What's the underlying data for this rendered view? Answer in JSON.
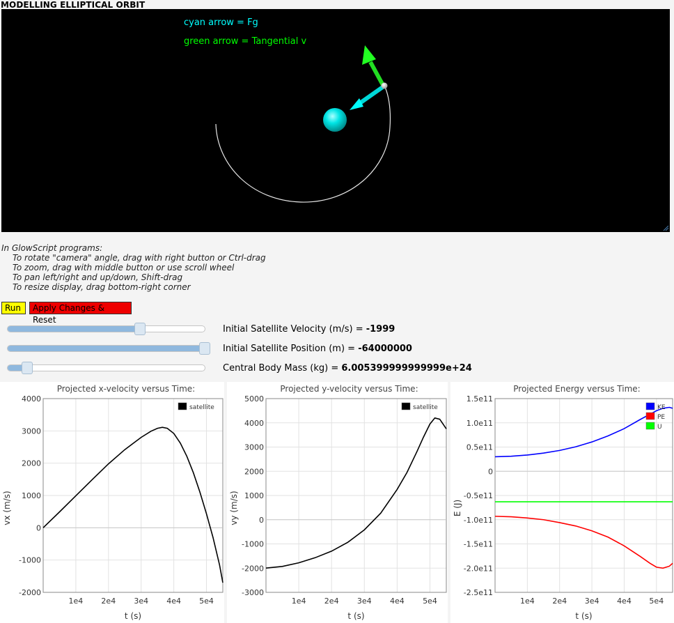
{
  "title": "MODELLING ELLIPTICAL ORBIT",
  "canvas": {
    "label_fg": "cyan arrow = Fg",
    "label_v": "green arrow = Tangential v",
    "colors": {
      "fg": "#00ffff",
      "v": "#00ff00",
      "central_body": "#00ffff"
    }
  },
  "instructions": {
    "heading": "In GlowScript programs:",
    "lines": [
      "To rotate \"camera\" angle, drag with right button or Ctrl-drag",
      "To zoom, drag with middle button or use scroll wheel",
      "To pan left/right and up/down, Shift-drag",
      "To resize display, drag bottom-right corner"
    ]
  },
  "buttons": {
    "run": "Run",
    "apply": "Apply Changes & Reset"
  },
  "sliders": [
    {
      "label": "Initial Satellite Velocity (m/s) = ",
      "value": "-1999",
      "fraction": 0.67
    },
    {
      "label": "Initial Satellite Position (m) = ",
      "value": "-64000000",
      "fraction": 1.0
    },
    {
      "label": "Central Body Mass (kg) = ",
      "value": "6.005399999999999e+24",
      "fraction": 0.1
    }
  ],
  "chart_data": [
    {
      "type": "line",
      "title": "Projected x-velocity versus Time:",
      "xlabel": "t (s)",
      "ylabel": "vx (m/s)",
      "xlim": [
        0,
        55000
      ],
      "ylim": [
        -2000,
        4000
      ],
      "xticks": [
        "1e4",
        "2e4",
        "3e4",
        "4e4",
        "5e4"
      ],
      "yticks": [
        "4000",
        "3000",
        "2000",
        "1000",
        "0",
        "-1000",
        "-2000"
      ],
      "legend": "top-right",
      "series": [
        {
          "name": "satellite",
          "color": "#000000",
          "x": [
            0,
            5000,
            10000,
            15000,
            20000,
            25000,
            30000,
            33000,
            35000,
            36500,
            38000,
            40000,
            42000,
            44000,
            46000,
            48000,
            50000,
            52000,
            54000,
            55000
          ],
          "y": [
            0,
            490,
            990,
            1490,
            1980,
            2420,
            2800,
            2990,
            3080,
            3110,
            3080,
            2920,
            2620,
            2210,
            1700,
            1100,
            430,
            -300,
            -1150,
            -1700
          ]
        }
      ]
    },
    {
      "type": "line",
      "title": "Projected y-velocity versus Time:",
      "xlabel": "t (s)",
      "ylabel": "vy (m/s)",
      "xlim": [
        0,
        55000
      ],
      "ylim": [
        -3000,
        5000
      ],
      "xticks": [
        "1e4",
        "2e4",
        "3e4",
        "4e4",
        "5e4"
      ],
      "yticks": [
        "5000",
        "4000",
        "3000",
        "2000",
        "1000",
        "0",
        "-1000",
        "-2000",
        "-3000"
      ],
      "legend": "top-right",
      "series": [
        {
          "name": "satellite",
          "color": "#000000",
          "x": [
            0,
            5000,
            10000,
            15000,
            20000,
            25000,
            30000,
            35000,
            40000,
            43000,
            46000,
            48000,
            50000,
            51500,
            53000,
            55000
          ],
          "y": [
            -1999,
            -1930,
            -1780,
            -1570,
            -1300,
            -930,
            -420,
            270,
            1250,
            1950,
            2800,
            3400,
            3950,
            4200,
            4150,
            3750
          ]
        }
      ]
    },
    {
      "type": "line",
      "title": "Projected Energy versus Time:",
      "xlabel": "t (s)",
      "ylabel": "E (J)",
      "xlim": [
        0,
        55000
      ],
      "ylim": [
        -250000000000.0,
        150000000000.0
      ],
      "xticks": [
        "1e4",
        "2e4",
        "3e4",
        "4e4",
        "5e4"
      ],
      "yticks": [
        "1.5e11",
        "1.0e11",
        "0.5e11",
        "0",
        "-0.5e11",
        "-1.0e11",
        "-1.5e11",
        "-2.0e11",
        "-2.5e11"
      ],
      "legend": "top-right",
      "series": [
        {
          "name": "KE",
          "color": "#0000ff",
          "x": [
            0,
            5000,
            10000,
            15000,
            20000,
            25000,
            30000,
            35000,
            40000,
            45000,
            50000,
            52000,
            54000,
            55000
          ],
          "y": [
            30000000000.0,
            31000000000.0,
            33500000000.0,
            37500000000.0,
            43000000000.0,
            50500000000.0,
            60500000000.0,
            73000000000.0,
            88000000000.0,
            107000000000.0,
            125000000000.0,
            130000000000.0,
            132000000000.0,
            130000000000.0
          ]
        },
        {
          "name": "PE",
          "color": "#ff0000",
          "x": [
            0,
            5000,
            10000,
            15000,
            20000,
            25000,
            30000,
            35000,
            40000,
            45000,
            48000,
            50000,
            52000,
            54000,
            55000
          ],
          "y": [
            -93000000000.0,
            -94000000000.0,
            -96500000000.0,
            -100000000000.0,
            -106000000000.0,
            -113000000000.0,
            -123000000000.0,
            -136000000000.0,
            -154000000000.0,
            -176000000000.0,
            -190000000000.0,
            -198000000000.0,
            -200000000000.0,
            -196000000000.0,
            -190000000000.0
          ]
        },
        {
          "name": "U",
          "color": "#00ff00",
          "x": [
            0,
            55000
          ],
          "y": [
            -63000000000.0,
            -63000000000.0
          ]
        }
      ]
    }
  ]
}
